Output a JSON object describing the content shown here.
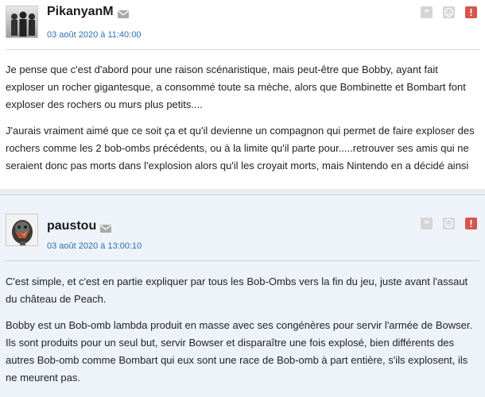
{
  "posts": [
    {
      "username": "PikanyanM",
      "date": "03 août 2020 à 11:40:00",
      "paragraphs": [
        "Je pense que c'est d'abord pour une raison scénaristique, mais peut-être que Bobby, ayant fait exploser un rocher gigantesque, a consommé toute sa mèche, alors que Bombinette et Bombart font exploser des rochers ou murs plus petits....",
        "J'aurais vraiment aimé que ce soit ça et qu'il devienne un compagnon qui permet de faire exploser des rochers comme les 2 bob-ombs précédents, ou à la limite qu'il parte pour.....retrouver ses amis qui ne seraient donc pas morts dans l'explosion alors qu'il les croyait morts, mais Nintendo en a décidé ainsi"
      ]
    },
    {
      "username": "paustou",
      "date": "03 août 2020 à 13:00:10",
      "paragraphs": [
        "C'est simple, et c'est en partie expliquer par tous les Bob-Ombs vers la fin du jeu, juste avant l'assaut du château de Peach.",
        "Bobby est un Bob-omb lambda produit en masse avec ses congénères pour servir l'armée de Bowser. Ils sont produits pour un seul but, servir Bowser et disparaître une fois explosé, bien différents des autres Bob-omb comme Bombart qui eux sont une race de Bob-omb à part entière, s'ils explosent, ils ne meurent pas."
      ]
    }
  ],
  "icons": {
    "mail": "envelope-icon",
    "quote": "quote-icon",
    "sad": "sad-face-icon",
    "report": "report-icon"
  },
  "colors": {
    "date_link": "#2a6fb4",
    "report": "#d9534f",
    "post2_bg": "#eef3fa"
  }
}
